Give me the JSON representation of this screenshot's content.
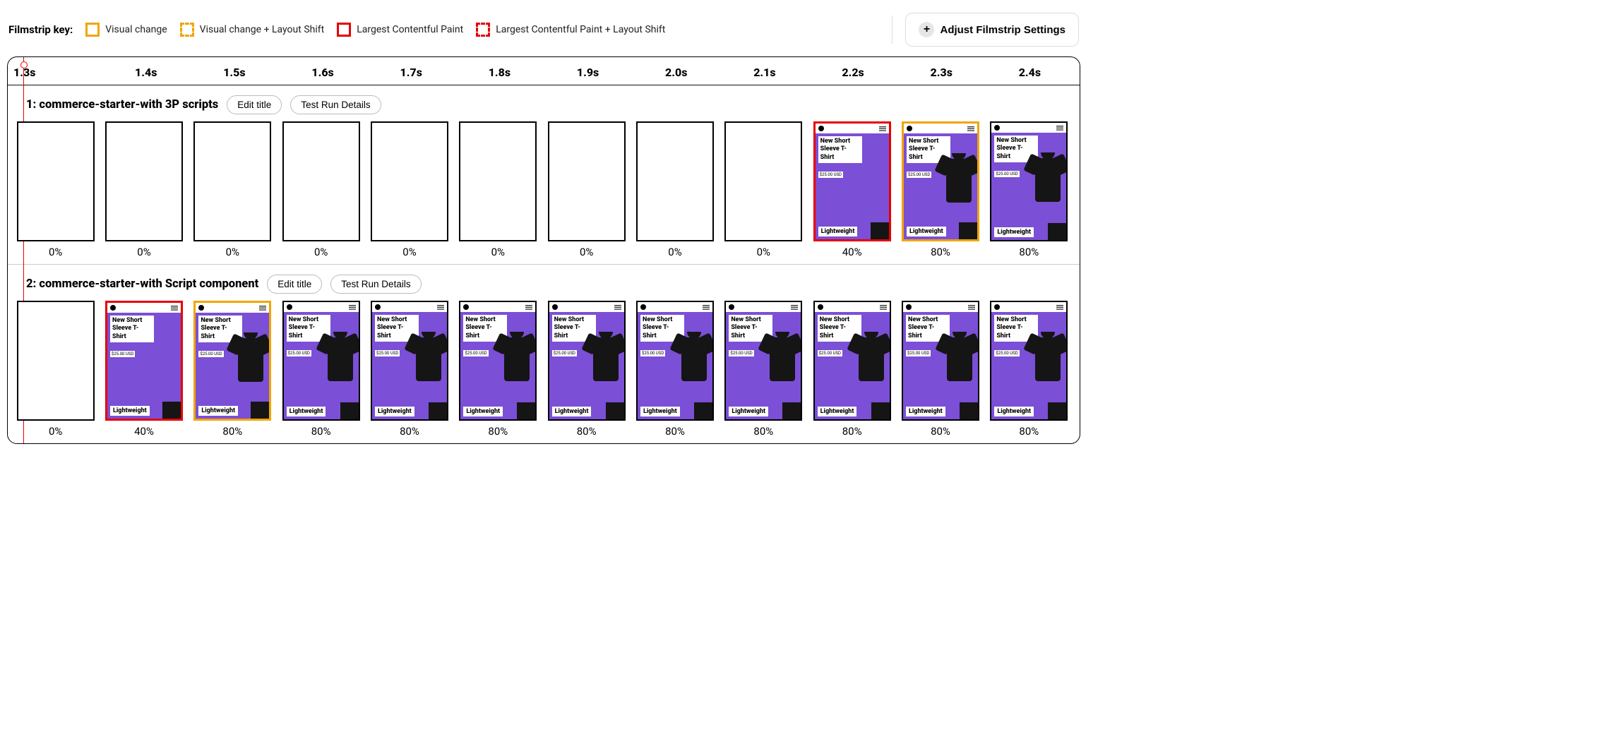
{
  "legend": {
    "label": "Filmstrip key:",
    "items": [
      {
        "text": "Visual change"
      },
      {
        "text": "Visual change + Layout Shift"
      },
      {
        "text": "Largest Contentful Paint"
      },
      {
        "text": "Largest Contentful Paint + Layout Shift"
      }
    ]
  },
  "adjust_button": "Adjust Filmstrip Settings",
  "time_ticks": [
    "1.3s",
    "1.4s",
    "1.5s",
    "1.6s",
    "1.7s",
    "1.8s",
    "1.9s",
    "2.0s",
    "2.1s",
    "2.2s",
    "2.3s",
    "2.4s"
  ],
  "thumbnail": {
    "title": "New Short Sleeve T-Shirt",
    "price": "$25.00 USD",
    "badge": "Lightweight"
  },
  "tests": [
    {
      "title": "1: commerce-starter-with 3P scripts",
      "edit_label": "Edit title",
      "details_label": "Test Run Details",
      "frames": [
        {
          "pct": "0%",
          "content": "blank",
          "border": "normal"
        },
        {
          "pct": "0%",
          "content": "blank",
          "border": "normal"
        },
        {
          "pct": "0%",
          "content": "blank",
          "border": "normal"
        },
        {
          "pct": "0%",
          "content": "blank",
          "border": "normal"
        },
        {
          "pct": "0%",
          "content": "blank",
          "border": "normal"
        },
        {
          "pct": "0%",
          "content": "blank",
          "border": "normal"
        },
        {
          "pct": "0%",
          "content": "blank",
          "border": "normal"
        },
        {
          "pct": "0%",
          "content": "blank",
          "border": "normal"
        },
        {
          "pct": "0%",
          "content": "blank",
          "border": "normal"
        },
        {
          "pct": "40%",
          "content": "purple",
          "border": "lcp"
        },
        {
          "pct": "80%",
          "content": "shirt",
          "border": "vc"
        },
        {
          "pct": "80%",
          "content": "shirt",
          "border": "normal"
        }
      ]
    },
    {
      "title": "2: commerce-starter-with Script component",
      "edit_label": "Edit title",
      "details_label": "Test Run Details",
      "frames": [
        {
          "pct": "0%",
          "content": "blank",
          "border": "normal"
        },
        {
          "pct": "40%",
          "content": "purple",
          "border": "lcp"
        },
        {
          "pct": "80%",
          "content": "shirt",
          "border": "vc"
        },
        {
          "pct": "80%",
          "content": "shirt",
          "border": "normal"
        },
        {
          "pct": "80%",
          "content": "shirt",
          "border": "normal"
        },
        {
          "pct": "80%",
          "content": "shirt",
          "border": "normal"
        },
        {
          "pct": "80%",
          "content": "shirt",
          "border": "normal"
        },
        {
          "pct": "80%",
          "content": "shirt",
          "border": "normal"
        },
        {
          "pct": "80%",
          "content": "shirt",
          "border": "normal"
        },
        {
          "pct": "80%",
          "content": "shirt",
          "border": "normal"
        },
        {
          "pct": "80%",
          "content": "shirt",
          "border": "normal"
        },
        {
          "pct": "80%",
          "content": "shirt",
          "border": "normal"
        }
      ]
    }
  ]
}
